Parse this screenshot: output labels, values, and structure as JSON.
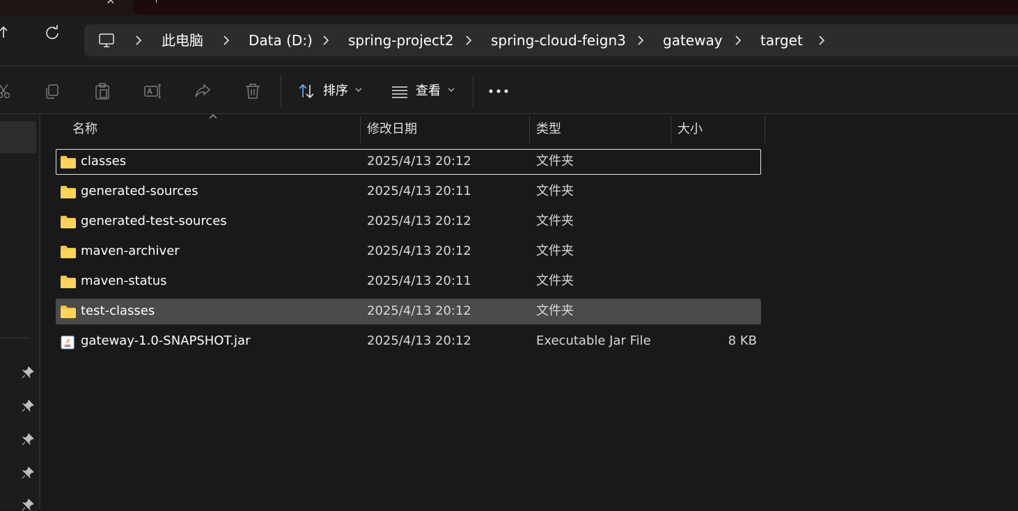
{
  "breadcrumb": {
    "items": [
      "此电脑",
      "Data (D:)",
      "spring-project2",
      "spring-cloud-feign3",
      "gateway",
      "target"
    ]
  },
  "toolbar": {
    "sort_label": "排序",
    "view_label": "查看",
    "icons": [
      "cut-icon",
      "copy-icon",
      "paste-icon",
      "rename-icon",
      "share-icon",
      "delete-icon",
      "sort-icon",
      "view-icon",
      "more-icon"
    ]
  },
  "columns": {
    "name": "名称",
    "modified": "修改日期",
    "type": "类型",
    "size": "大小"
  },
  "files": [
    {
      "name": "classes",
      "modified": "2025/4/13 20:12",
      "type": "文件夹",
      "size": "",
      "icon": "folder-icon"
    },
    {
      "name": "generated-sources",
      "modified": "2025/4/13 20:11",
      "type": "文件夹",
      "size": "",
      "icon": "folder-icon"
    },
    {
      "name": "generated-test-sources",
      "modified": "2025/4/13 20:12",
      "type": "文件夹",
      "size": "",
      "icon": "folder-icon"
    },
    {
      "name": "maven-archiver",
      "modified": "2025/4/13 20:12",
      "type": "文件夹",
      "size": "",
      "icon": "folder-icon"
    },
    {
      "name": "maven-status",
      "modified": "2025/4/13 20:11",
      "type": "文件夹",
      "size": "",
      "icon": "folder-icon"
    },
    {
      "name": "test-classes",
      "modified": "2025/4/13 20:12",
      "type": "文件夹",
      "size": "",
      "icon": "folder-icon"
    },
    {
      "name": "gateway-1.0-SNAPSHOT.jar",
      "modified": "2025/4/13 20:12",
      "type": "Executable Jar File",
      "size": "8 KB",
      "icon": "java-jar-icon"
    }
  ],
  "colors": {
    "background": "#191919",
    "folder": "#f5c542",
    "accent_sort": "#6cb6ff",
    "hover_row": "#4a4a4a"
  }
}
